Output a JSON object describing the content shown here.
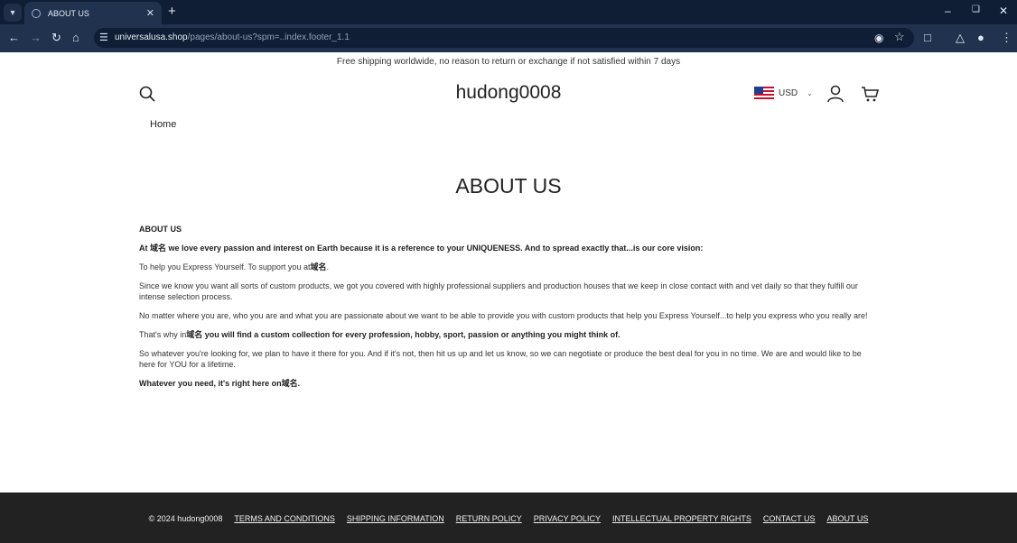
{
  "browser": {
    "tab_title": "ABOUT US",
    "new_tab_label": "+",
    "url_domain": "universalusa.shop",
    "url_path": "/pages/about-us?spm=..index.footer_1.1",
    "colors": {
      "tabbar": "#0f1e35",
      "toolbar": "#21324f"
    }
  },
  "store": {
    "announcement": "Free shipping worldwide, no reason to return or exchange if not satisfied within 7 days",
    "logo": "hudong0008",
    "currency": "USD",
    "nav": {
      "home": "Home"
    }
  },
  "page": {
    "title": "ABOUT US",
    "heading": "ABOUT US",
    "p1": "At 域名 we love every passion and interest on Earth because it is a reference to your UNIQUENESS. And to spread exactly that...is our core vision:",
    "p2a": "To help you Express Yourself. To support you at",
    "p2b": "域名",
    "p2c": ".",
    "p3": "Since we know you want all sorts of custom products, we got you covered with highly professional suppliers and production houses that we keep in close contact with and vet daily so that they fulfill our intense selection process.",
    "p4": "No matter where you are, who you are and what you are passionate about we want to be able to provide you with custom products that help you Express Yourself...to help you express who you really are!",
    "p5a": "That's why in",
    "p5b": "域名 you will find a custom collection for every profession, hobby, sport, passion or anything you might think of.",
    "p6": "So whatever you're looking for, we plan to have it there for you. And if it's not, then hit us up and let us know, so we can negotiate or produce the best deal for you in no time. We are and would like to be here for YOU for a lifetime.",
    "p7": "Whatever you need, it's right here on域名."
  },
  "footer": {
    "copyright": "© 2024 hudong0008",
    "links": [
      "TERMS AND CONDITIONS",
      "SHIPPING INFORMATION",
      "RETURN POLICY",
      "PRIVACY POLICY",
      "INTELLECTUAL PROPERTY RIGHTS",
      "CONTACT US",
      "ABOUT US"
    ],
    "background": "#222222"
  }
}
